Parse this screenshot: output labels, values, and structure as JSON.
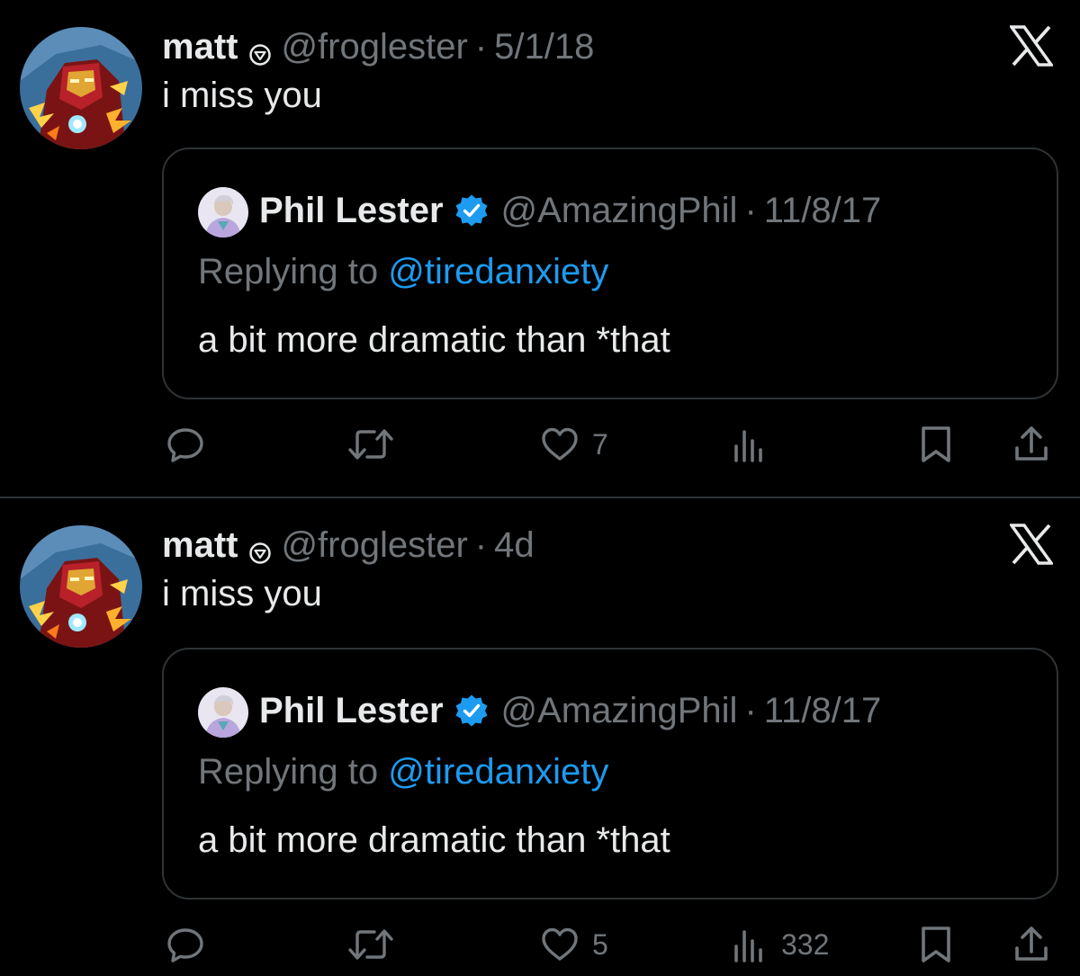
{
  "tweets": [
    {
      "author": {
        "name": "matt",
        "handle": "@froglester",
        "avatar_icon": "comic-hero-avatar",
        "badge_icon": "subscriber-badge-icon"
      },
      "separator": "·",
      "date": "5/1/18",
      "text": "i miss you",
      "quote": {
        "author": {
          "name": "Phil Lester",
          "handle": "@AmazingPhil",
          "avatar_icon": "person-avatar",
          "verified_icon": "verified-badge-icon",
          "verified_color": "#1d9bf0"
        },
        "separator": "·",
        "date": "11/8/17",
        "reply_prefix": "Replying to",
        "reply_to": "@tiredanxiety",
        "text": "a bit more dramatic than *that"
      },
      "actions": {
        "reply_count": "",
        "retweet_count": "",
        "like_count": "7",
        "views_count": ""
      }
    },
    {
      "author": {
        "name": "matt",
        "handle": "@froglester",
        "avatar_icon": "comic-hero-avatar",
        "badge_icon": "subscriber-badge-icon"
      },
      "separator": "·",
      "date": "4d",
      "text": "i miss you",
      "quote": {
        "author": {
          "name": "Phil Lester",
          "handle": "@AmazingPhil",
          "avatar_icon": "person-avatar",
          "verified_icon": "verified-badge-icon",
          "verified_color": "#1d9bf0"
        },
        "separator": "·",
        "date": "11/8/17",
        "reply_prefix": "Replying to",
        "reply_to": "@tiredanxiety",
        "text": "a bit more dramatic than *that"
      },
      "actions": {
        "reply_count": "",
        "retweet_count": "",
        "like_count": "5",
        "views_count": "332"
      }
    }
  ],
  "colors": {
    "background": "#000000",
    "text_primary": "#e7e9ea",
    "text_secondary": "#71767b",
    "link": "#1d9bf0",
    "border": "#2f3336"
  },
  "brand_icon": "x-logo-icon"
}
